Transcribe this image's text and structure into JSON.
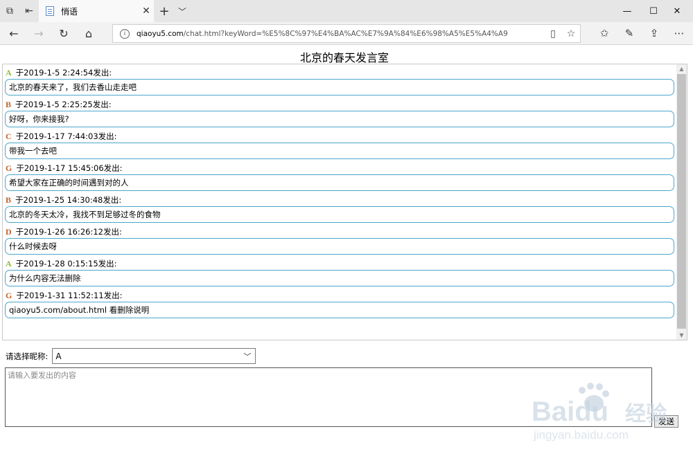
{
  "browser": {
    "tab_title": "悄语",
    "url_host": "qiaoyu5.com",
    "url_path": "/chat.html?keyWord=%E5%8C%97%E4%BA%AC%E7%9A%84%E6%98%A5%E5%A4%A9"
  },
  "page": {
    "room_title": "北京的春天发言室",
    "nick_label": "请选择昵称:",
    "nick_value": "A",
    "input_placeholder": "请输入要发出的内容",
    "send_label": "发送"
  },
  "messages": [
    {
      "nick": "A",
      "nick_color": "#8dbb3a",
      "meta": "于2019-1-5 2:24:54发出:",
      "text": "北京的春天来了，我们去香山走走吧"
    },
    {
      "nick": "B",
      "nick_color": "#c0672c",
      "meta": "于2019-1-5 2:25:25发出:",
      "text": "好呀，你来接我?"
    },
    {
      "nick": "C",
      "nick_color": "#c0672c",
      "meta": "于2019-1-17 7:44:03发出:",
      "text": "带我一个去吧"
    },
    {
      "nick": "G",
      "nick_color": "#c0672c",
      "meta": "于2019-1-17 15:45:06发出:",
      "text": "希望大家在正确的时间遇到对的人"
    },
    {
      "nick": "B",
      "nick_color": "#c0672c",
      "meta": "于2019-1-25 14:30:48发出:",
      "text": "北京的冬天太冷，我找不到足够过冬的食物"
    },
    {
      "nick": "D",
      "nick_color": "#c0672c",
      "meta": "于2019-1-26 16:26:12发出:",
      "text": "什么时候去呀"
    },
    {
      "nick": "A",
      "nick_color": "#8dbb3a",
      "meta": "于2019-1-28 0:15:15发出:",
      "text": "为什么内容无法删除"
    },
    {
      "nick": "G",
      "nick_color": "#c0672c",
      "meta": "于2019-1-31 11:52:11发出:",
      "text": "qiaoyu5.com/about.html 看删除说明"
    }
  ],
  "watermark": {
    "brand": "Baidu",
    "cn": "经验",
    "url": "jingyan.baidu.com"
  }
}
